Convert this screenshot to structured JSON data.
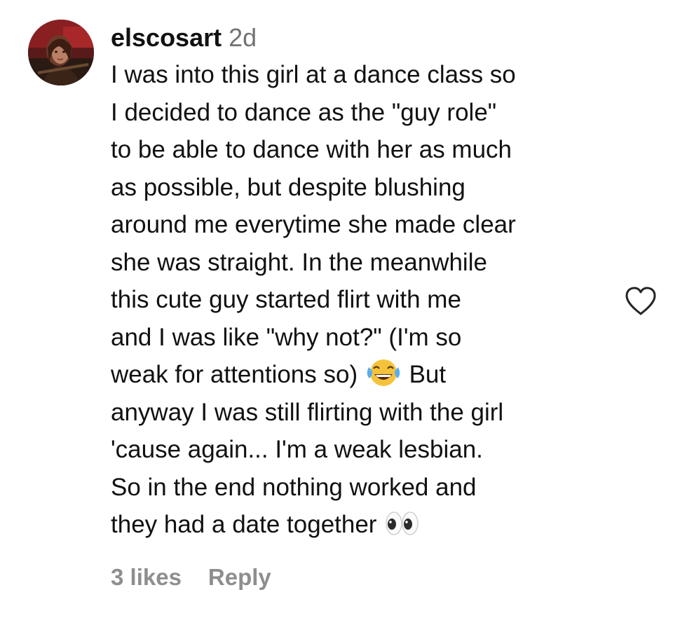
{
  "comment": {
    "username": "elscosart",
    "timestamp": "2d",
    "lines": [
      "I was into this girl at a dance class so",
      "I decided to dance as the \"guy role\"",
      "to be able to dance with her as much",
      "as possible, but despite blushing",
      "around me everytime she made clear",
      "she was straight. In the meanwhile",
      "this cute guy started flirt with me",
      "and I was like \"why not?\" (I'm so"
    ],
    "line9_before": "weak for attentions so) ",
    "line9_emoji": "face-with-tears-of-joy",
    "line9_after": " But",
    "lines_after": [
      "anyway I was still flirting with the girl",
      "'cause again... I'm a weak lesbian.",
      "So in the end nothing worked and"
    ],
    "last_line_text": "they had a date together ",
    "last_line_emoji": "eyes",
    "likes_label": "3 likes",
    "reply_label": "Reply"
  },
  "icons": {
    "like": "heart-outline-icon",
    "avatar": "user-avatar"
  },
  "colors": {
    "text": "#111111",
    "muted": "#737373",
    "actions": "#8e8e8e",
    "heart_stroke": "#262626"
  }
}
